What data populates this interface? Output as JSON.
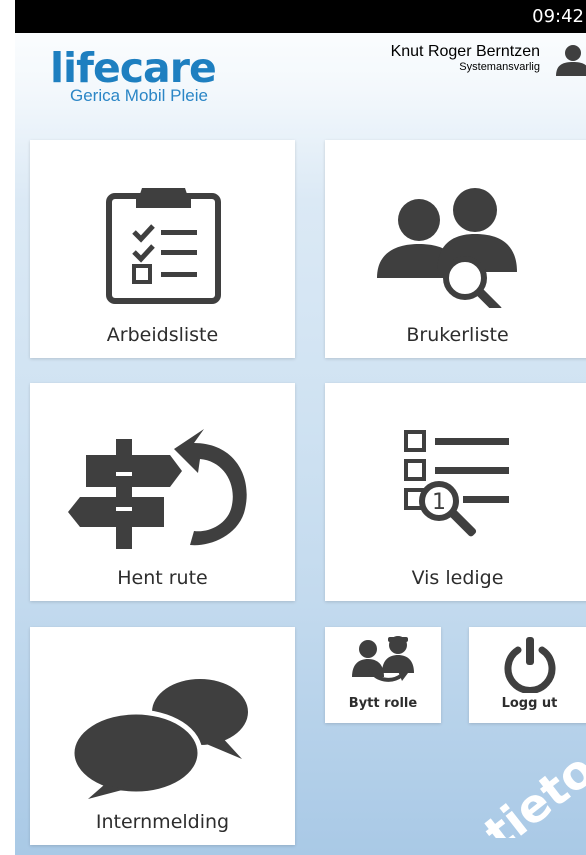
{
  "statusbar": {
    "time": "09:42"
  },
  "brand": {
    "name": "lifecare",
    "product": "Gerica Mobil Pleie"
  },
  "user": {
    "name": "Knut Roger Berntzen",
    "role": "Systemansvarlig"
  },
  "tiles": {
    "arbeidsliste": "Arbeidsliste",
    "brukerliste": "Brukerliste",
    "hent_rute": "Hent rute",
    "vis_ledige": "Vis ledige",
    "internmelding": "Internmelding",
    "bytt_rolle": "Bytt rolle",
    "logg_ut": "Logg ut"
  },
  "watermark": "tieto",
  "colors": {
    "brand_blue": "#1e7fc0",
    "icon_gray": "#3f3f3f",
    "status_bar": "#000000"
  }
}
